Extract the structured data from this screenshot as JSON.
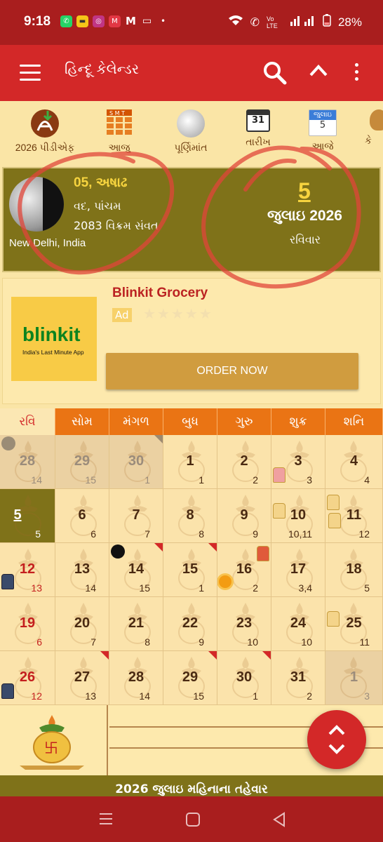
{
  "status_bar": {
    "time": "9:18",
    "battery": "28%",
    "network_label": "Vo LTE"
  },
  "toolbar": {
    "title": "હિન્દૂ કેલેન્ડર"
  },
  "quick_actions": [
    {
      "label": "2026 પીડીએફ",
      "icon": "pdf-download-icon"
    },
    {
      "label": "આજુ",
      "icon": "grid-calendar-icon"
    },
    {
      "label": "પૂર્ણિમાંત",
      "icon": "full-moon-icon"
    },
    {
      "label": "તારીખ",
      "icon": "date-icon"
    },
    {
      "label": "આજે",
      "icon": "today-icon"
    },
    {
      "label": "કે",
      "icon": "more-icon"
    }
  ],
  "today_icon": {
    "month": "જુલાઇ",
    "day": "5"
  },
  "date_icon": {
    "day": "31"
  },
  "panchang": {
    "tithi": "05, અષાઢ",
    "paksha": "વદ, પાંચમ",
    "samvat": "2083 વિક્રમ સંવત",
    "location": "New Delhi, India",
    "date": "5",
    "month_year": "જુલાઇ 2026",
    "weekday": "રવિવાર"
  },
  "ad": {
    "brand": "blinkit",
    "tagline": "India's Last Minute App",
    "title": "Blinkit Grocery",
    "tag": "Ad",
    "button": "ORDER NOW"
  },
  "calendar": {
    "weekdays": [
      "રવિ",
      "સોમ",
      "મંગળ",
      "બુધ",
      "ગુરુ",
      "શુક્ર",
      "શનિ"
    ],
    "weeks": [
      [
        {
          "d": "28",
          "t": "14",
          "out": true
        },
        {
          "d": "29",
          "t": "15",
          "out": true
        },
        {
          "d": "30",
          "t": "1",
          "out": true
        },
        {
          "d": "1",
          "t": "1"
        },
        {
          "d": "2",
          "t": "2"
        },
        {
          "d": "3",
          "t": "3"
        },
        {
          "d": "4",
          "t": "4"
        }
      ],
      [
        {
          "d": "5",
          "t": "5",
          "today": true
        },
        {
          "d": "6",
          "t": "6"
        },
        {
          "d": "7",
          "t": "7"
        },
        {
          "d": "8",
          "t": "8"
        },
        {
          "d": "9",
          "t": "9"
        },
        {
          "d": "10",
          "t": "10,11"
        },
        {
          "d": "11",
          "t": "12"
        }
      ],
      [
        {
          "d": "12",
          "t": "13"
        },
        {
          "d": "13",
          "t": "14"
        },
        {
          "d": "14",
          "t": "15"
        },
        {
          "d": "15",
          "t": "1"
        },
        {
          "d": "16",
          "t": "2"
        },
        {
          "d": "17",
          "t": "3,4"
        },
        {
          "d": "18",
          "t": "5"
        }
      ],
      [
        {
          "d": "19",
          "t": "6"
        },
        {
          "d": "20",
          "t": "7"
        },
        {
          "d": "21",
          "t": "8"
        },
        {
          "d": "22",
          "t": "9"
        },
        {
          "d": "23",
          "t": "10"
        },
        {
          "d": "24",
          "t": "10"
        },
        {
          "d": "25",
          "t": "11"
        }
      ],
      [
        {
          "d": "26",
          "t": "12"
        },
        {
          "d": "27",
          "t": "13"
        },
        {
          "d": "28",
          "t": "14"
        },
        {
          "d": "29",
          "t": "15"
        },
        {
          "d": "30",
          "t": "1"
        },
        {
          "d": "31",
          "t": "2"
        },
        {
          "d": "1",
          "t": "3",
          "out": true
        }
      ]
    ]
  },
  "festivals_banner": "2026 જુલાઇ મહિનાના તહેવાર",
  "colors": {
    "status_bar": "#a91e1e",
    "toolbar": "#d32828",
    "panel_olive": "#7f7219",
    "weekday_header": "#ea7414",
    "cell_bg": "#fbe3ab"
  }
}
